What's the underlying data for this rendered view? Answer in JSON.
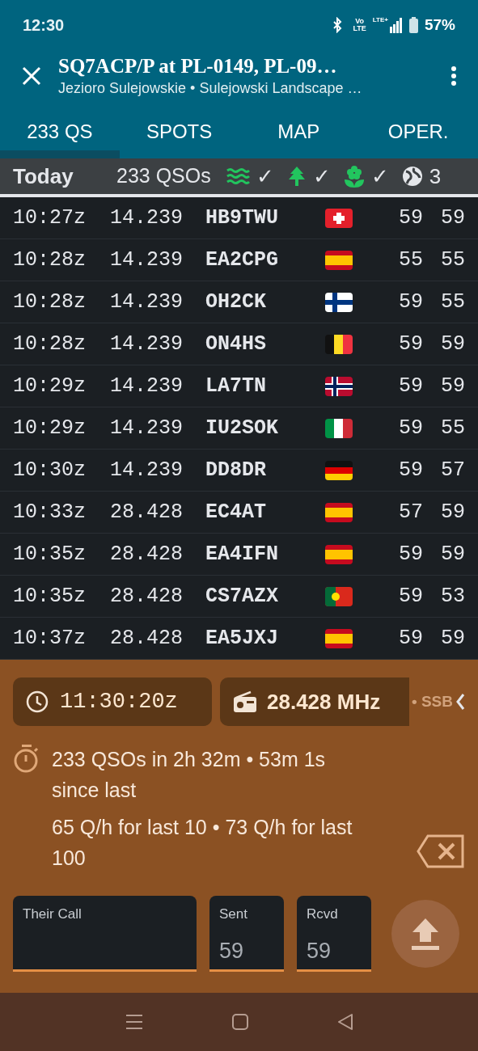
{
  "status_bar": {
    "time": "12:30",
    "volte": [
      "Vo",
      "LTE"
    ],
    "network": "LTE+",
    "battery": "57%"
  },
  "header": {
    "title": "SQ7ACP/P at PL-0149, PL-09…",
    "subtitle": "Jezioro Sulejowskie • Sulejowski Landscape …"
  },
  "tabs": [
    {
      "label": "233 QS",
      "selected": true
    },
    {
      "label": "SPOTS",
      "selected": false
    },
    {
      "label": "MAP",
      "selected": false
    },
    {
      "label": "OPER.",
      "selected": false
    }
  ],
  "summary": {
    "title": "Today",
    "count": "233 QSOs",
    "refs": [
      {
        "kind": "water",
        "mark": "✓"
      },
      {
        "kind": "tree",
        "mark": "✓"
      },
      {
        "kind": "flower",
        "mark": "✓"
      },
      {
        "kind": "globe",
        "mark": "3"
      }
    ]
  },
  "qsos": [
    {
      "time": "10:27z",
      "freq": "14.239",
      "call": "HB9TWU",
      "kind": "swiss",
      "sent": "59",
      "rcvd": "59"
    },
    {
      "time": "10:28z",
      "freq": "14.239",
      "call": "EA2CPG",
      "kind": "spanish",
      "sent": "55",
      "rcvd": "55"
    },
    {
      "time": "10:28z",
      "freq": "14.239",
      "call": "OH2CK",
      "kind": "finnish",
      "sent": "59",
      "rcvd": "55"
    },
    {
      "time": "10:28z",
      "freq": "14.239",
      "call": "ON4HS",
      "kind": "belgian",
      "sent": "59",
      "rcvd": "59"
    },
    {
      "time": "10:29z",
      "freq": "14.239",
      "call": "LA7TN",
      "kind": "norwegian",
      "sent": "59",
      "rcvd": "59"
    },
    {
      "time": "10:29z",
      "freq": "14.239",
      "call": "IU2SOK",
      "kind": "italian",
      "sent": "59",
      "rcvd": "55"
    },
    {
      "time": "10:30z",
      "freq": "14.239",
      "call": "DD8DR",
      "kind": "german",
      "sent": "59",
      "rcvd": "57"
    },
    {
      "time": "10:33z",
      "freq": "28.428",
      "call": "EC4AT",
      "kind": "spanish",
      "sent": "57",
      "rcvd": "59"
    },
    {
      "time": "10:35z",
      "freq": "28.428",
      "call": "EA4IFN",
      "kind": "spanish",
      "sent": "59",
      "rcvd": "59"
    },
    {
      "time": "10:35z",
      "freq": "28.428",
      "call": "CS7AZX",
      "kind": "portuguese",
      "sent": "59",
      "rcvd": "53"
    },
    {
      "time": "10:37z",
      "freq": "28.428",
      "call": "EA5JXJ",
      "kind": "spanish",
      "sent": "59",
      "rcvd": "59"
    }
  ],
  "entry": {
    "clock": "11:30:20z",
    "frequency": "28.428 MHz",
    "mode": "• SSB",
    "stats": [
      "233 QSOs in 2h 32m • 53m 1s since last",
      "65 Q/h for last 10 • 73 Q/h for last 100"
    ],
    "fields": [
      {
        "label": "Their Call"
      },
      {
        "label": "Sent",
        "value": "59"
      },
      {
        "label": "Rcvd",
        "value": "59"
      }
    ]
  }
}
